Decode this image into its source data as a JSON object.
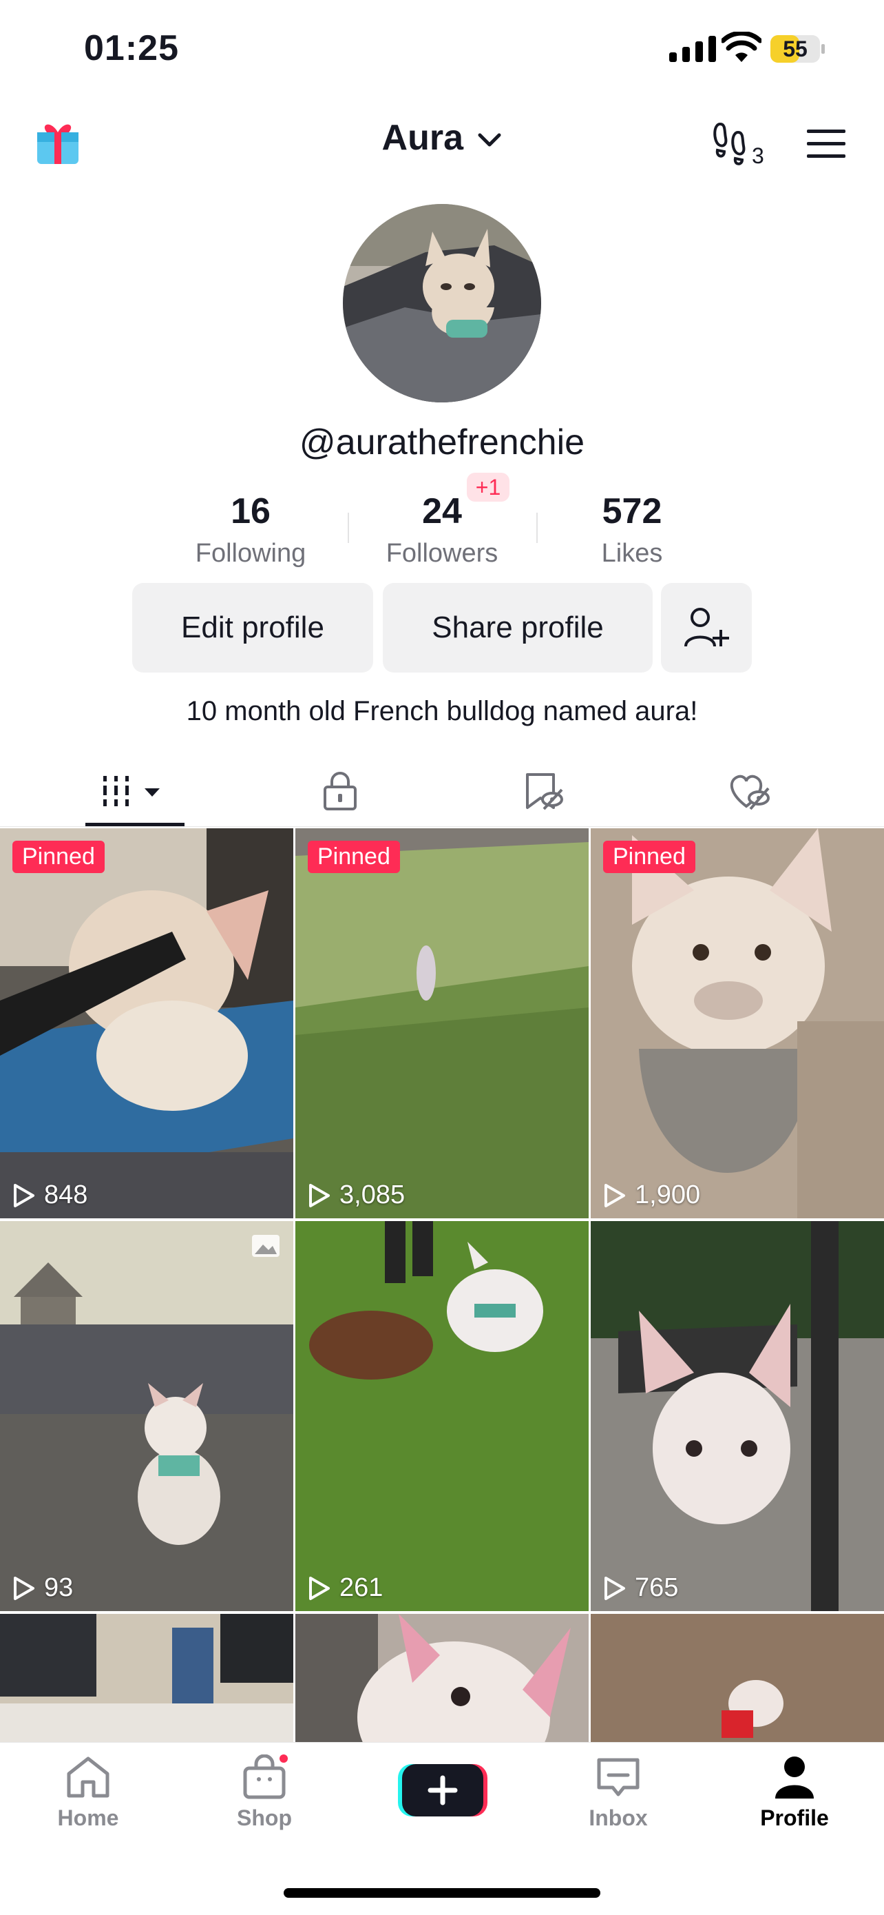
{
  "status_bar": {
    "time": "01:25",
    "battery": "55"
  },
  "header": {
    "title": "Aura",
    "footprint_count": "3"
  },
  "profile": {
    "username": "@aurathefrenchie",
    "stats": [
      {
        "value": "16",
        "label": "Following"
      },
      {
        "value": "24",
        "label": "Followers",
        "badge": "+1"
      },
      {
        "value": "572",
        "label": "Likes"
      }
    ],
    "bio": "10 month old French bulldog named aura!"
  },
  "actions": {
    "edit": "Edit profile",
    "share": "Share profile"
  },
  "tabs": [
    "videos-grid-icon",
    "lock-icon",
    "hidden-bookmark-icon",
    "hidden-heart-icon"
  ],
  "grid": [
    {
      "pinned": "Pinned",
      "views": "848"
    },
    {
      "pinned": "Pinned",
      "views": "3,085"
    },
    {
      "pinned": "Pinned",
      "views": "1,900"
    },
    {
      "views": "93",
      "photo": true
    },
    {
      "views": "261"
    },
    {
      "views": "765"
    }
  ],
  "nav": {
    "home": "Home",
    "shop": "Shop",
    "inbox": "Inbox",
    "profile": "Profile"
  },
  "colors": {
    "accent": "#fe2c55",
    "cyan": "#25f4ee",
    "text": "#161823",
    "muted": "#8a8b91"
  }
}
